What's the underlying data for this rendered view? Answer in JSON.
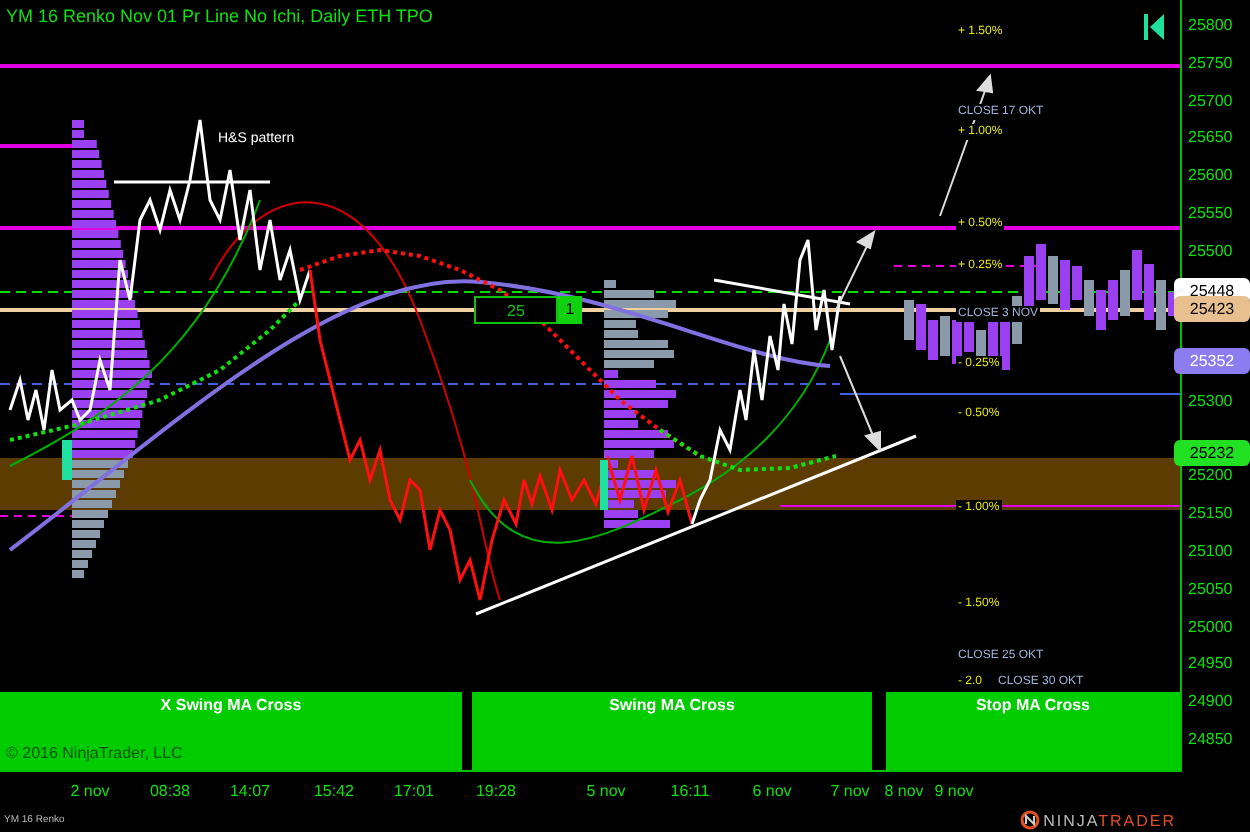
{
  "chart": {
    "title": "YM 16 Renko Nov 01  Pr Line No Ichi, Daily ETH TPO",
    "annotations": [
      {
        "text": "H&S pattern",
        "kind": "label"
      },
      {
        "text": "+ 1.50%",
        "kind": "pct"
      },
      {
        "text": "CLOSE 17 OKT",
        "kind": "close"
      },
      {
        "text": "+ 1.00%",
        "kind": "pct"
      },
      {
        "text": "+ 0.50%",
        "kind": "pct"
      },
      {
        "text": "+ 0.25%",
        "kind": "pct"
      },
      {
        "text": "CLOSE 3 NOV",
        "kind": "close"
      },
      {
        "text": "- 0.25%",
        "kind": "pct"
      },
      {
        "text": "- 0.50%",
        "kind": "pct"
      },
      {
        "text": "- 1.00%",
        "kind": "pct"
      },
      {
        "text": "- 1.50%",
        "kind": "pct"
      },
      {
        "text": "CLOSE 25 OKT",
        "kind": "close"
      },
      {
        "text": "- 2.0",
        "kind": "pct"
      },
      {
        "text": "CLOSE 30 OKT",
        "kind": "close"
      }
    ],
    "counter": {
      "value": "25",
      "badge": "1"
    },
    "strategy_panels": [
      "X Swing MA Cross",
      "Swing MA Cross",
      "Stop MA Cross"
    ],
    "copyright": "© 2016 NinjaTrader, LLC"
  },
  "price_axis": {
    "ticks": [
      "25800",
      "25750",
      "25700",
      "25650",
      "25600",
      "25550",
      "25500",
      "25300",
      "25200",
      "25150",
      "25100",
      "25050",
      "25000",
      "24950",
      "24900",
      "24850"
    ],
    "markers": [
      {
        "text": "25448",
        "color": "#ffffff"
      },
      {
        "text": "25423",
        "color": "#e8c090"
      },
      {
        "text": "25352",
        "color": "#8c7cf0"
      },
      {
        "text": "25232",
        "color": "#22e022"
      }
    ]
  },
  "time_axis": [
    "2 nov",
    "08:38",
    "14:07",
    "15:42",
    "17:01",
    "19:28",
    "5 nov",
    "16:11",
    "6 nov",
    "7 nov",
    "8 nov",
    "9 nov"
  ],
  "instrument_label": "YM 16 Renko",
  "brand": {
    "part_1": "NINJA",
    "part_2": "TRADER"
  }
}
